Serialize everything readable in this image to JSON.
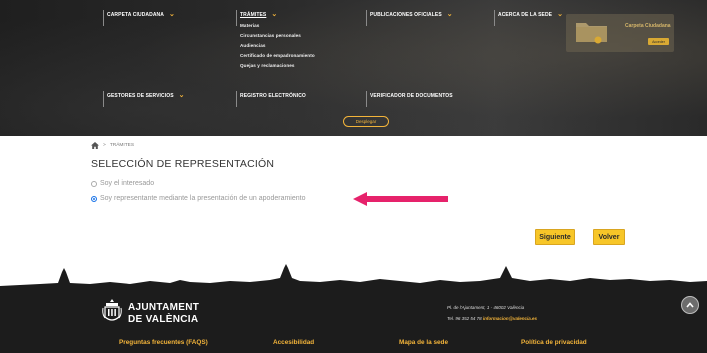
{
  "nav": {
    "carpeta": "CARPETA CIUDADANA",
    "tramites": "TRÁMITES",
    "publicaciones": "PUBLICACIONES OFICIALES",
    "acerca": "ACERCA DE LA SEDE",
    "gestores": "GESTORES DE SERVICIOS",
    "registro": "REGISTRO ELECTRÓNICO",
    "verificador": "VERIFICADOR DE DOCUMENTOS",
    "submenu": [
      "Materias",
      "Circunstancias personales",
      "Audiencias",
      "Certificado de empadronamiento",
      "Quejas y reclamaciones"
    ],
    "desplegar": "Desplegar"
  },
  "carpeta_card": {
    "title": "Carpeta Ciudadana",
    "button": "Acceder"
  },
  "breadcrumb": {
    "current": "TRÁMITES",
    "separator": ">"
  },
  "page_title": "SELECCIÓN DE REPRESENTACIÓN",
  "options": [
    {
      "label": "Soy el interesado",
      "checked": false
    },
    {
      "label": "Soy representante mediante la presentación de un apoderamiento",
      "checked": true
    }
  ],
  "buttons": {
    "siguiente": "Siguiente",
    "volver": "Volver"
  },
  "footer": {
    "logo_line1": "AJUNTAMENT",
    "logo_line2": "DE VALÈNCIA",
    "address": "Pl. de l'Ajuntament, 1 - 46002 València",
    "phone": "Tel. 96 352 54 78",
    "email": "informacion@valencia.es",
    "links": [
      "Preguntas frecuentes (FAQS)",
      "Accesibilidad",
      "Mapa de la sede",
      "Política de privacidad"
    ]
  },
  "colors": {
    "accent": "#f3b43a",
    "button": "#f7c628",
    "arrow": "#e6226b",
    "radio_checked": "#1a73e8"
  }
}
